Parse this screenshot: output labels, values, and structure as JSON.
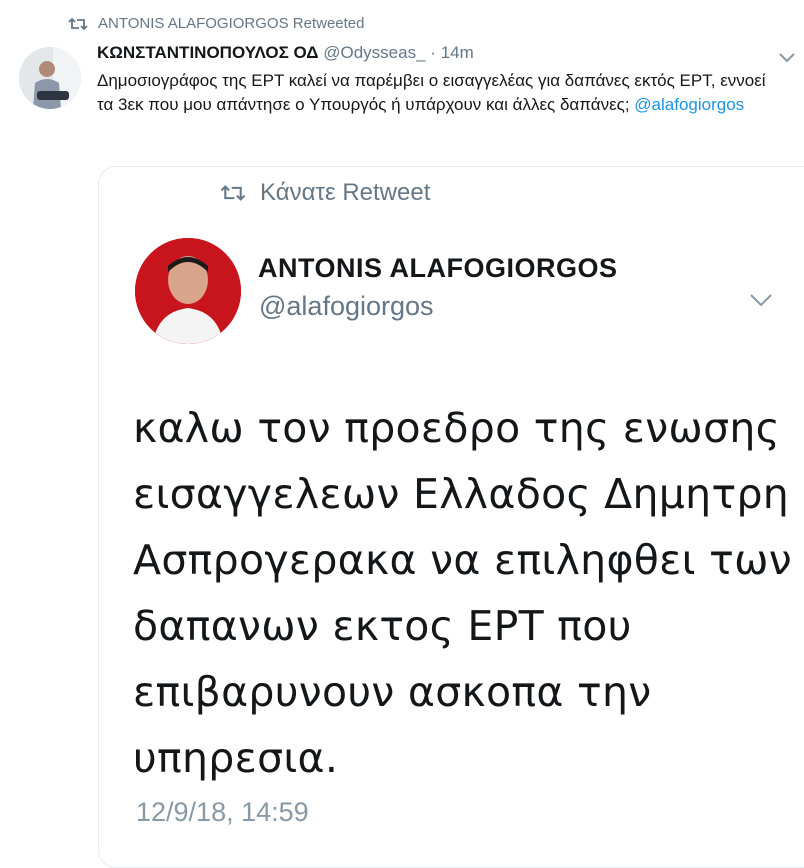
{
  "retweet_context": {
    "icon": "retweet-icon",
    "text": "ANTONIS ALAFOGIORGOS Retweeted"
  },
  "tweet": {
    "display_name": "ΚΩΝΣΤΑΝΤΙΝΟΠΟΥΛΟΣ ΟΔ",
    "handle": "@Odysseas_",
    "separator": "·",
    "time": "14m",
    "text_main": "Δημοσιογράφος της ΕΡΤ καλεί να παρέμβει ο εισαγγελέας για δαπάνες εκτός ΕΡΤ, εννοεί τα 3εκ που μου απάντησε ο Υπουργός ή υπάρχουν και άλλες δαπάνες;",
    "mention": "@alafogiorgos"
  },
  "embedded": {
    "retweet_label": "Κάνατε Retweet",
    "display_name": "ANTONIS ALAFOGIORGOS",
    "handle": "@alafogiorgos",
    "body_lines": [
      "καλω τον προεδρο της ενωσης",
      "εισαγγελεων Ελλαδος Δημητρη",
      "Ασπρογερακα να επιληφθει των",
      "δαπανων εκτος ΕΡΤ που",
      "επιβαρυνουν ασκοπα την",
      "υπηρεσια."
    ],
    "date": "12/9/18, 14:59"
  },
  "colors": {
    "link": "#1b95e0",
    "muted": "#657786",
    "text": "#14171a",
    "border": "#e6ecf0"
  }
}
